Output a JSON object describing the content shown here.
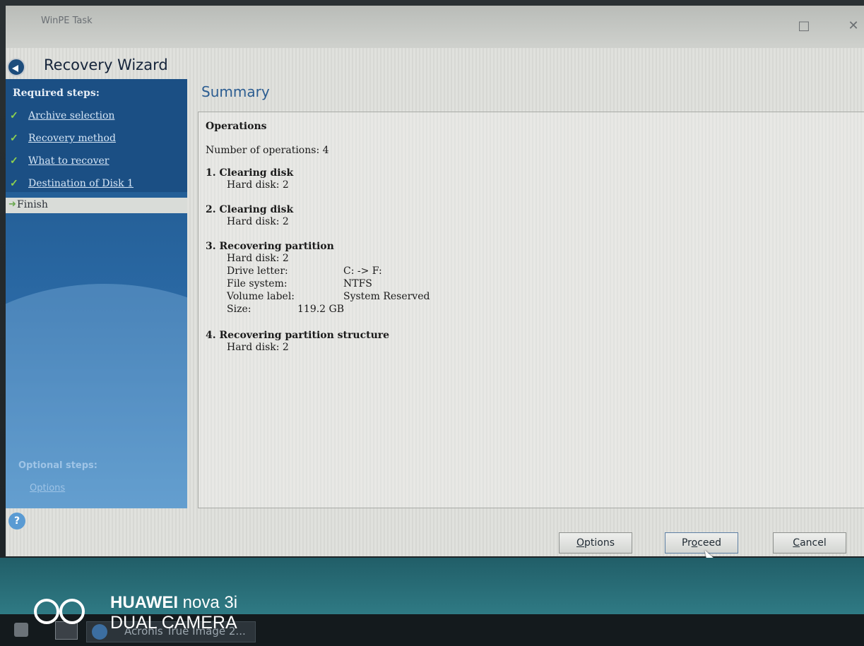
{
  "window": {
    "title": "WinPE Task",
    "maximize_glyph": "□",
    "close_glyph": "✕"
  },
  "wizard": {
    "title": "Recovery Wizard",
    "back_icon": "back-arrow-icon"
  },
  "sidebar": {
    "required_label": "Required steps:",
    "steps": [
      {
        "label": "Archive selection",
        "check": "✓"
      },
      {
        "label": "Recovery method",
        "check": "✓"
      },
      {
        "label": "What to recover",
        "check": "✓"
      },
      {
        "label": "Destination of Disk 1",
        "check": "✓"
      }
    ],
    "finish_label": "Finish",
    "finish_arrow": "➜",
    "optional_label": "Optional steps:",
    "options_link": "Options",
    "help_glyph": "?"
  },
  "summary": {
    "title": "Summary",
    "operations_heading": "Operations",
    "number_of_operations": "Number of operations: 4",
    "ops": [
      {
        "heading": "1. Clearing disk",
        "hard_disk": "Hard disk:  2"
      },
      {
        "heading": "2. Clearing disk",
        "hard_disk": "Hard disk:  2"
      },
      {
        "heading": "3. Recovering partition",
        "hard_disk": "Hard disk:  2",
        "drive_letter_k": "Drive letter:",
        "drive_letter_v": "C: -> F:",
        "file_system_k": "File system:",
        "file_system_v": "NTFS",
        "volume_label_k": "Volume label:",
        "volume_label_v": "System Reserved",
        "size_k": "Size:",
        "size_v": "119.2 GB"
      },
      {
        "heading": "4. Recovering partition structure",
        "hard_disk": "Hard disk:  2"
      }
    ]
  },
  "buttons": {
    "options": {
      "first": "O",
      "rest": "ptions"
    },
    "proceed": {
      "first": "Pr",
      "mid": "o",
      "rest": "ceed"
    },
    "cancel": {
      "first": "C",
      "rest": "ancel"
    }
  },
  "taskbar": {
    "task_label": "Acronis True Image 2..."
  },
  "watermark": {
    "brand": "HUAWEI",
    "model": "nova 3i",
    "line2": "DUAL CAMERA"
  }
}
